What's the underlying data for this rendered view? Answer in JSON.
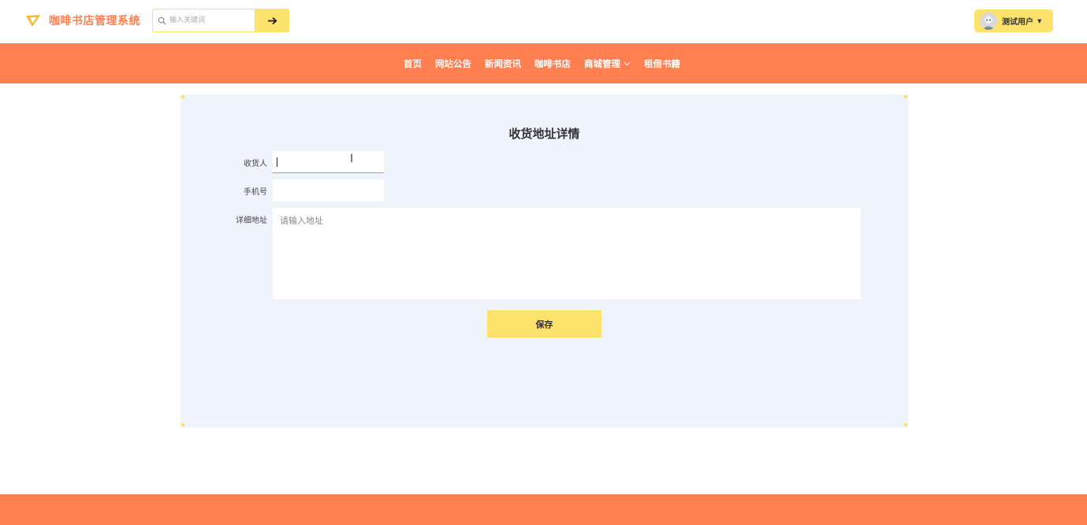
{
  "header": {
    "brand_title": "咖啡书店管理系统",
    "search_placeholder": "输入关键词",
    "user_name": "测试用户"
  },
  "nav": {
    "items": [
      "首页",
      "网站公告",
      "新闻资讯",
      "咖啡书店",
      "商城管理",
      "租借书籍"
    ]
  },
  "form": {
    "title": "收货地址详情",
    "receiver_label": "收货人",
    "receiver_value": "",
    "phone_label": "手机号",
    "phone_value": "",
    "address_label": "详细地址",
    "address_placeholder": "请输入地址",
    "save_label": "保存"
  },
  "colors": {
    "primary": "#ff7f50",
    "accent": "#fde36b",
    "panel_bg": "#eff3fb"
  },
  "icons": {
    "brand": "paper-plane-icon",
    "search": "search-icon",
    "submit": "arrow-right-icon",
    "caret": "caret-down-icon",
    "chevron": "chevron-down-icon"
  }
}
